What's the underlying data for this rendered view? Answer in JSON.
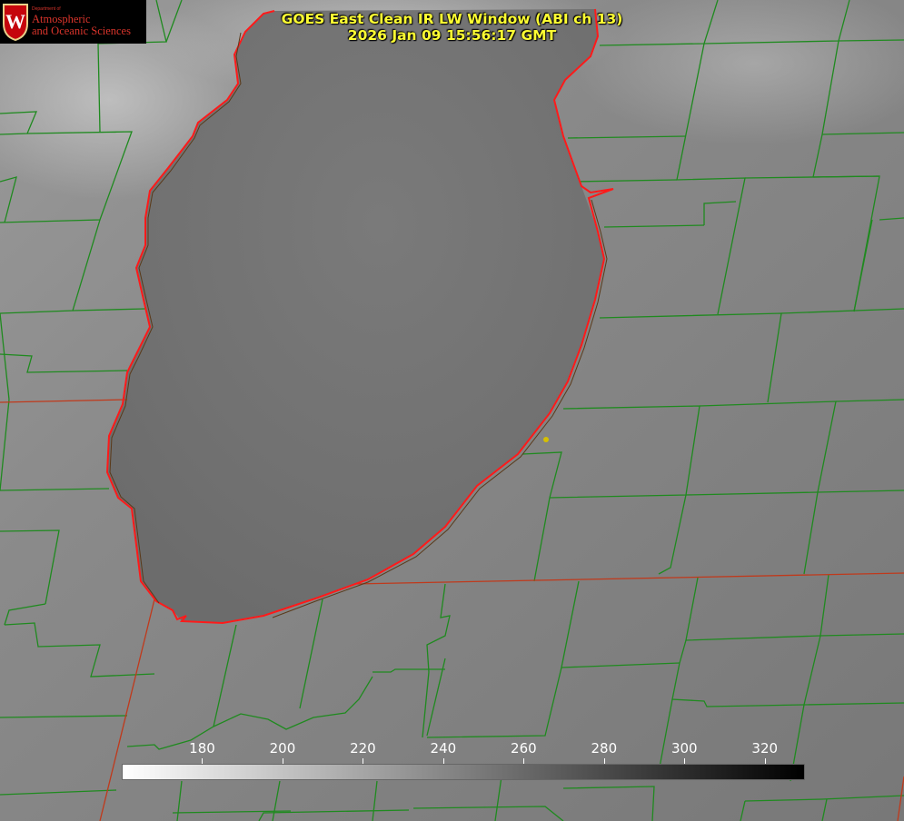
{
  "title": {
    "line1": "GOES East Clean IR LW Window (ABI ch 13)",
    "line2": "2026 Jan 09 15:56:17 GMT"
  },
  "logo": {
    "department": "Department of",
    "line1": "Atmospheric",
    "line2": "and Oceanic Sciences",
    "seal_letter": "W"
  },
  "colorbar": {
    "min": 160,
    "max": 330,
    "ticks": [
      180,
      200,
      220,
      240,
      260,
      280,
      300,
      320
    ],
    "start_color": "#ffffff",
    "end_color": "#000000"
  },
  "colors": {
    "title": "#ffff33",
    "county_lines": "#1f8a1f",
    "state_lines": "#c0391b",
    "lake_outline": "#ff1a1a",
    "marker": "#d6c000"
  }
}
